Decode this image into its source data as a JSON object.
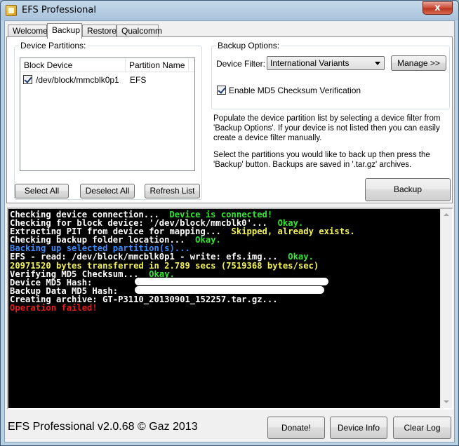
{
  "window": {
    "title": "EFS Professional",
    "close_glyph": "x"
  },
  "tabs": [
    {
      "label": "Welcome",
      "active": false
    },
    {
      "label": "Backup",
      "active": true
    },
    {
      "label": "Restore",
      "active": false
    },
    {
      "label": "Qualcomm",
      "active": false
    }
  ],
  "partitions": {
    "group_label": "Device Partitions:",
    "columns": [
      "Block Device",
      "Partition Name"
    ],
    "rows": [
      {
        "checked": true,
        "block_device": "/dev/block/mmcblk0p1",
        "partition_name": "EFS"
      }
    ],
    "select_all": "Select All",
    "deselect_all": "Deselect All",
    "refresh_list": "Refresh List"
  },
  "backup_options": {
    "group_label": "Backup Options:",
    "filter_label": "Device Filter:",
    "filter_value": "International Variants",
    "manage_label": "Manage >>",
    "md5_checked": true,
    "md5_label": "Enable MD5 Checksum Verification"
  },
  "info": {
    "paragraph1": "Populate the device partition list by selecting a device filter from 'Backup Options'. If your device is not listed then you can easily create a device filter manually.",
    "paragraph2": "Select the partitions you would like to back up then press the 'Backup' button. Backups are saved in '.tar.gz' archives."
  },
  "backup_button": "Backup",
  "colors": {
    "white": "#ffffff",
    "green": "#33e633",
    "yellow": "#f2f25a",
    "blue": "#3d8af7",
    "red": "#e61b1b"
  },
  "console": [
    [
      {
        "t": "Checking device connection...  ",
        "c": "white"
      },
      {
        "t": "Device is connected!",
        "c": "green"
      }
    ],
    [
      {
        "t": "Checking for block device: '/dev/block/mmcblk0'...  ",
        "c": "white"
      },
      {
        "t": "Okay.",
        "c": "green"
      }
    ],
    [
      {
        "t": "Extracting PIT from device for mapping...  ",
        "c": "white"
      },
      {
        "t": "Skipped, already exists.",
        "c": "yellow"
      }
    ],
    [
      {
        "t": "Checking backup folder location...  ",
        "c": "white"
      },
      {
        "t": "Okay.",
        "c": "green"
      }
    ],
    [
      {
        "t": "Backing up selected partition(s)...",
        "c": "blue"
      }
    ],
    [
      {
        "t": "EFS - read: /dev/block/mmcblk0p1 - write: efs.img...  ",
        "c": "white"
      },
      {
        "t": "Okay.",
        "c": "green"
      }
    ],
    [
      {
        "t": "20971520 bytes transferred in 2.789 secs (7519368 bytes/sec)",
        "c": "yellow"
      }
    ],
    [
      {
        "t": "Verifying MD5 Checksum...  ",
        "c": "white"
      },
      {
        "t": "Okay.",
        "c": "green"
      }
    ],
    [
      {
        "t": "Device MD5 Hash:",
        "c": "white"
      }
    ],
    [
      {
        "t": "Backup Data MD5 Hash:",
        "c": "white"
      }
    ],
    [
      {
        "t": "Creating archive: GT-P3110_20130901_152257.tar.gz...",
        "c": "white"
      }
    ],
    [
      {
        "t": "Operation failed!",
        "c": "red"
      }
    ]
  ],
  "footer": {
    "title": "EFS Professional v2.0.68 © Gaz 2013",
    "donate": "Donate!",
    "device_info": "Device Info",
    "clear_log": "Clear Log"
  }
}
